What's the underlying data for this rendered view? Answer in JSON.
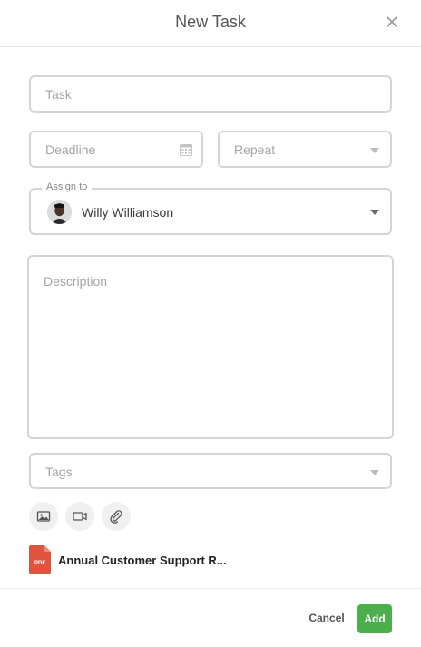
{
  "header": {
    "title": "New Task"
  },
  "form": {
    "task_placeholder": "Task",
    "deadline_placeholder": "Deadline",
    "repeat_placeholder": "Repeat",
    "assign_label": "Assign to",
    "assign_value": "Willy Williamson",
    "description_placeholder": "Description",
    "tags_placeholder": "Tags"
  },
  "media_buttons": [
    "image-icon",
    "video-icon",
    "paperclip-icon"
  ],
  "attachment": {
    "type_label": "PDF",
    "file_name": "Annual Customer Support R...",
    "icon_color": "#e0533f"
  },
  "footer": {
    "cancel_label": "Cancel",
    "add_label": "Add"
  },
  "colors": {
    "accent": "#4cae4c",
    "border": "#d5d5d5"
  }
}
